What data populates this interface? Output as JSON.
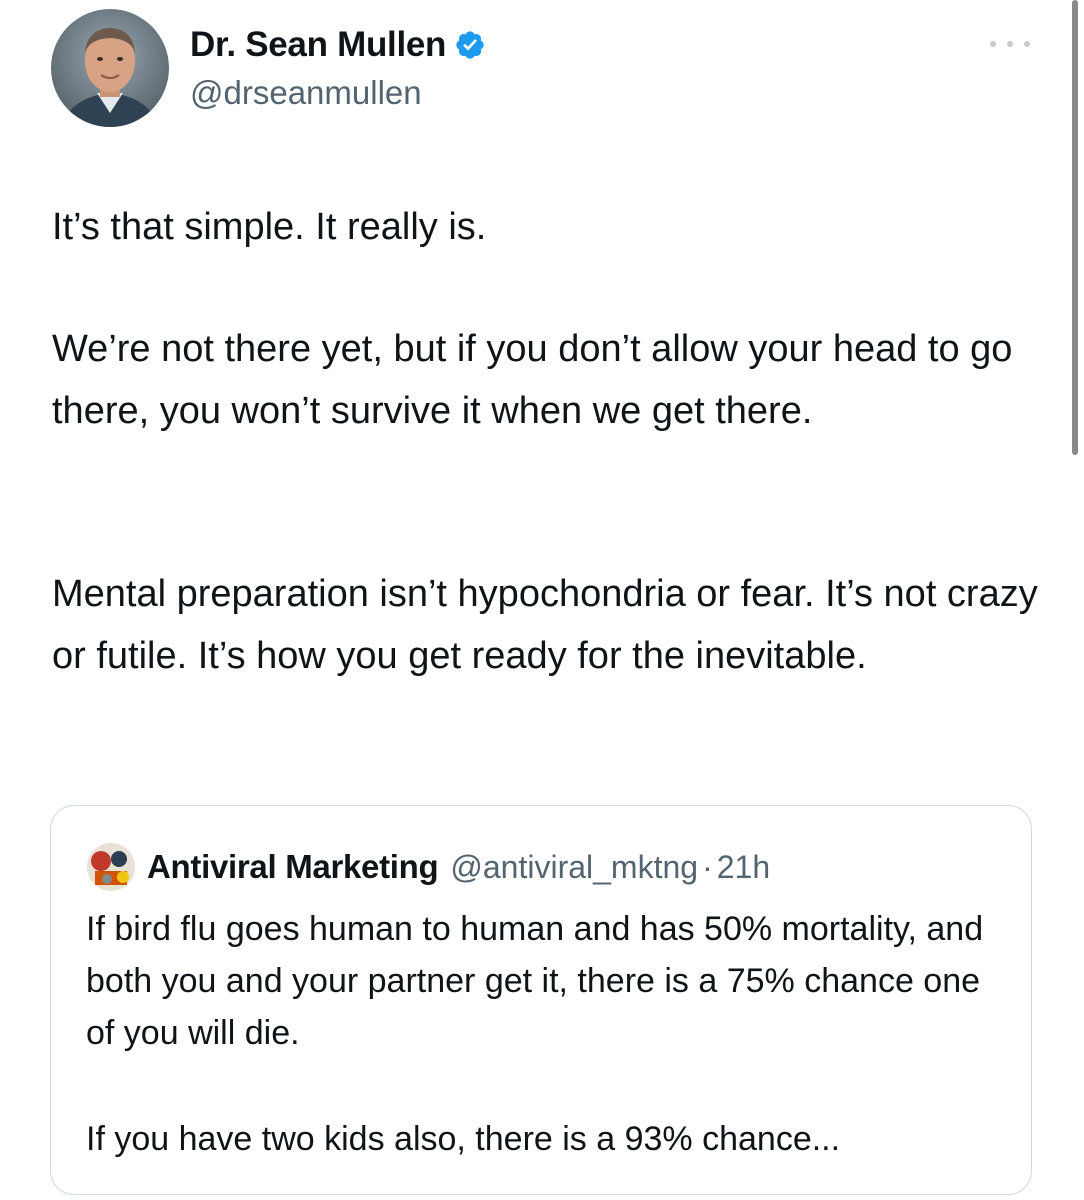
{
  "author": {
    "name": "Dr. Sean Mullen",
    "handle": "@drseanmullen",
    "verified": true
  },
  "tweet": {
    "paragraphs": [
      "It’s that simple. It really is.",
      "We’re not there yet, but if you don’t allow your head to go there, you won’t survive it when we get there.",
      "Mental preparation isn’t hypochondria or fear. It’s not crazy or futile. It’s how you get ready for the inevitable."
    ]
  },
  "quote": {
    "name": "Antiviral Marketing",
    "handle": "@antiviral_mktng",
    "separator": "·",
    "time": "21h",
    "paragraphs": [
      "If bird flu goes human to human and has 50% mortality, and both you and your partner get it, there is a 75% chance one of you will die.",
      "If you have two kids also, there is a 93% chance..."
    ]
  },
  "icons": {
    "verified": "verified-badge-icon",
    "more": "more-options-icon"
  },
  "colors": {
    "verified_blue": "#1d9bf0",
    "secondary_text": "#536471",
    "border": "#cfd9de"
  }
}
